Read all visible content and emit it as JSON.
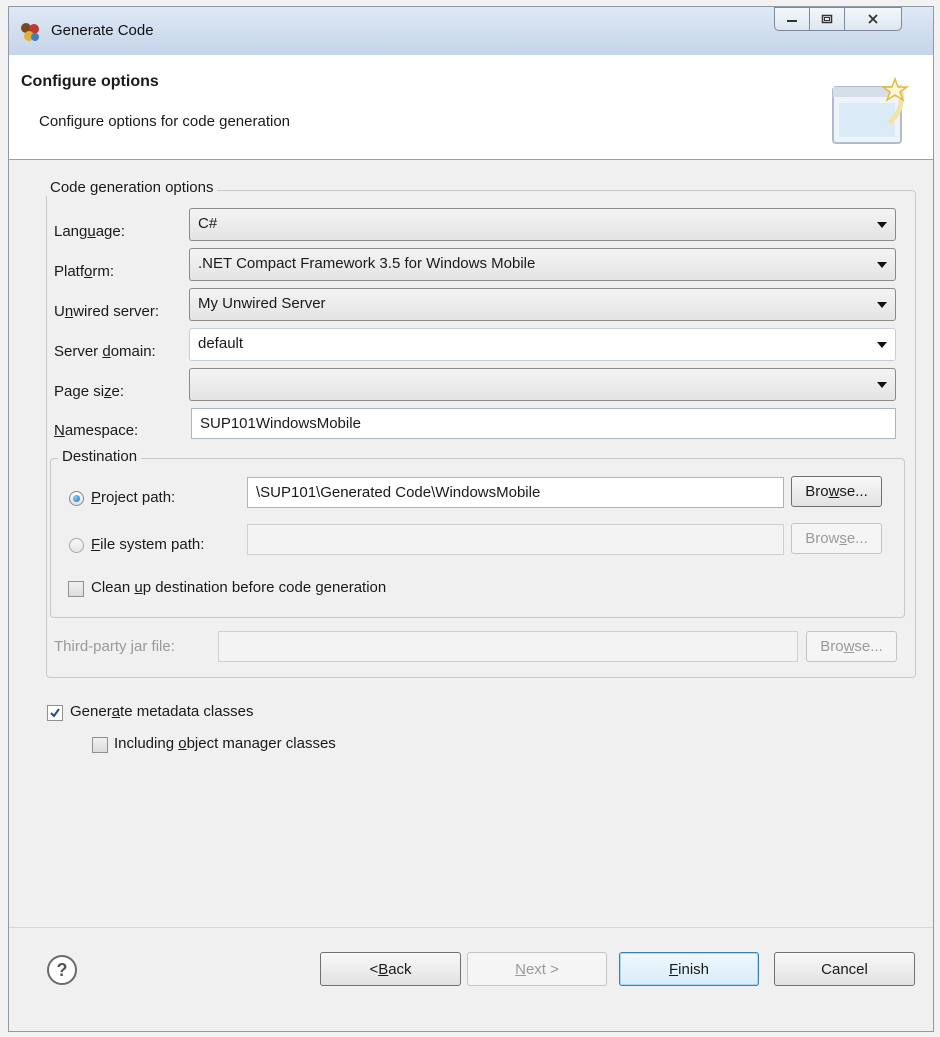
{
  "window": {
    "title": "Generate Code",
    "min_icon": "minimize-icon",
    "max_icon": "maximize-icon",
    "close_icon": "close-icon"
  },
  "banner": {
    "title": "Configure options",
    "description": "Configure options for code generation"
  },
  "code_generation_options": {
    "legend": "Code generation options",
    "language": {
      "label_pre": "Lang",
      "label_mn": "u",
      "label_post": "age:",
      "value": "C#"
    },
    "platform": {
      "label_pre": "Platf",
      "label_mn": "o",
      "label_post": "rm:",
      "value": ".NET Compact Framework 3.5 for Windows Mobile"
    },
    "unwired_server": {
      "label_pre": "U",
      "label_mn": "n",
      "label_post": "wired server:",
      "value": "My Unwired Server"
    },
    "server_domain": {
      "label_pre": "Server ",
      "label_mn": "d",
      "label_post": "omain:",
      "value": "default"
    },
    "page_size": {
      "label_pre": "Page si",
      "label_mn": "z",
      "label_post": "e:",
      "value": ""
    },
    "namespace": {
      "label_pre": "",
      "label_mn": "N",
      "label_post": "amespace:",
      "value": "SUP101WindowsMobile"
    }
  },
  "destination": {
    "legend": "Destination",
    "project_path": {
      "label_pre": "",
      "label_mn": "P",
      "label_post": "roject path:",
      "value": "\\SUP101\\Generated Code\\WindowsMobile",
      "selected": true
    },
    "file_system_path": {
      "label_pre": "",
      "label_mn": "F",
      "label_post": "ile system path:",
      "value": "",
      "selected": false
    },
    "browse_pre": "Bro",
    "browse_mn": "w",
    "browse_post": "se...",
    "browse2_pre": "Brow",
    "browse2_mn": "s",
    "browse2_post": "e...",
    "cleanup": {
      "label_pre": "Clean ",
      "label_mn": "u",
      "label_post": "p destination before code generation",
      "checked": false
    }
  },
  "third_party": {
    "label": "Third-party jar file:",
    "value": "",
    "browse_pre": "Bro",
    "browse_mn": "w",
    "browse_post": "se..."
  },
  "metadata": {
    "label_pre": "Gener",
    "label_mn": "a",
    "label_post": "te metadata classes",
    "checked": true,
    "object_manager": {
      "label_pre": "Including ",
      "label_mn": "o",
      "label_post": "bject manager classes",
      "checked": false
    }
  },
  "footer": {
    "help": "?",
    "back_pre": "< ",
    "back_mn": "B",
    "back_post": "ack",
    "next_pre": "",
    "next_mn": "N",
    "next_post": "ext >",
    "finish_pre": "",
    "finish_mn": "F",
    "finish_post": "inish",
    "cancel": "Cancel"
  }
}
